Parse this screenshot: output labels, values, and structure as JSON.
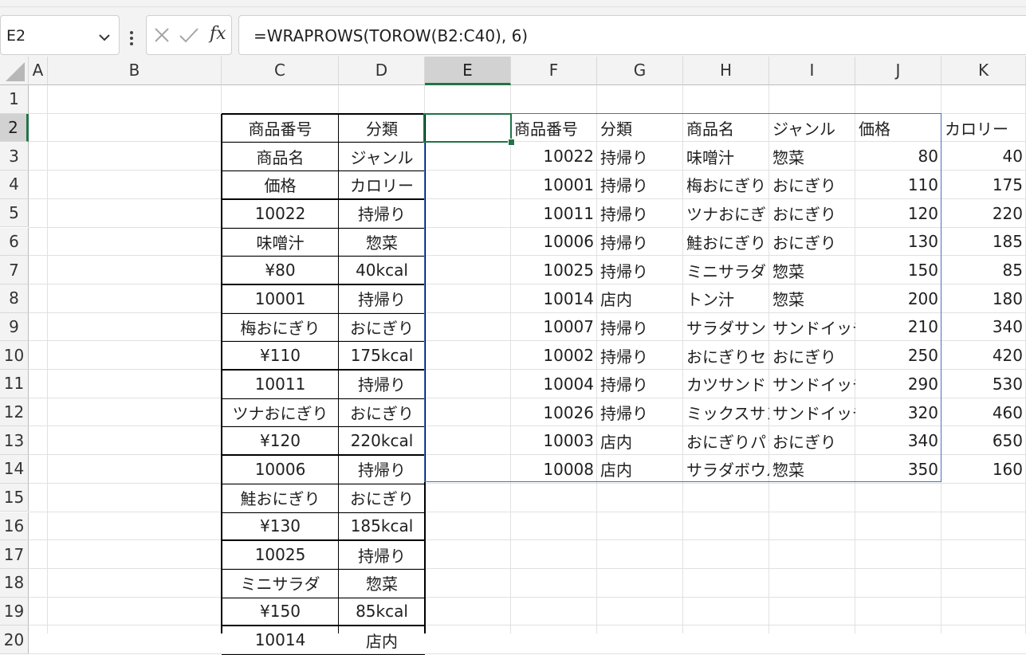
{
  "formula_bar": {
    "name_box": "E2",
    "fx_label": "fx",
    "formula": "=WRAPROWS(TOROW(B2:C40), 6)"
  },
  "icons": {
    "name_box_dropdown": "chevron-down-icon",
    "options": "vertical-dots-icon",
    "cancel": "x-icon",
    "enter": "check-icon",
    "insert_function": "fx-icon",
    "select_all": "select-all-triangle-icon"
  },
  "colors": {
    "selection": "#217346",
    "spill_border": "#4472c4",
    "header_bg": "#f3f3f3",
    "gridline": "#e1e1e1"
  },
  "sheet": {
    "columns": [
      "A",
      "B",
      "C",
      "D",
      "E",
      "F",
      "G",
      "H",
      "I",
      "J",
      "K"
    ],
    "rows": [
      "1",
      "2",
      "3",
      "4",
      "5",
      "6",
      "7",
      "8",
      "9",
      "10",
      "11",
      "12",
      "13",
      "14",
      "15",
      "16",
      "17",
      "18",
      "19",
      "20"
    ],
    "selected_column": "E",
    "selected_row": "2",
    "source_table": [
      [
        "商品番号",
        "分類"
      ],
      [
        "商品名",
        "ジャンル"
      ],
      [
        "価格",
        "カロリー"
      ],
      [
        "10022",
        "持帰り"
      ],
      [
        "味噌汁",
        "惣菜"
      ],
      [
        "¥80",
        "40kcal"
      ],
      [
        "10001",
        "持帰り"
      ],
      [
        "梅おにぎり",
        "おにぎり"
      ],
      [
        "¥110",
        "175kcal"
      ],
      [
        "10011",
        "持帰り"
      ],
      [
        "ツナおにぎり",
        "おにぎり"
      ],
      [
        "¥120",
        "220kcal"
      ],
      [
        "10006",
        "持帰り"
      ],
      [
        "鮭おにぎり",
        "おにぎり"
      ],
      [
        "¥130",
        "185kcal"
      ],
      [
        "10025",
        "持帰り"
      ],
      [
        "ミニサラダ",
        "惣菜"
      ],
      [
        "¥150",
        "85kcal"
      ],
      [
        "10014",
        "店内"
      ]
    ],
    "result_header": [
      "商品番号",
      "分類",
      "商品名",
      "ジャンル",
      "価格",
      "カロリー"
    ],
    "result_rows": [
      [
        "10022",
        "持帰り",
        "味噌汁",
        "惣菜",
        "80",
        "40"
      ],
      [
        "10001",
        "持帰り",
        "梅おにぎり",
        "おにぎり",
        "110",
        "175"
      ],
      [
        "10011",
        "持帰り",
        "ツナおにぎり",
        "おにぎり",
        "120",
        "220"
      ],
      [
        "10006",
        "持帰り",
        "鮭おにぎり",
        "おにぎり",
        "130",
        "185"
      ],
      [
        "10025",
        "持帰り",
        "ミニサラダ",
        "惣菜",
        "150",
        "85"
      ],
      [
        "10014",
        "店内",
        "トン汁",
        "惣菜",
        "200",
        "180"
      ],
      [
        "10007",
        "持帰り",
        "サラダサンド",
        "サンドイッチ",
        "210",
        "340"
      ],
      [
        "10002",
        "持帰り",
        "おにぎりセット",
        "おにぎり",
        "250",
        "420"
      ],
      [
        "10004",
        "持帰り",
        "カツサンド",
        "サンドイッチ",
        "290",
        "530"
      ],
      [
        "10026",
        "持帰り",
        "ミックスサンド",
        "サンドイッチ",
        "320",
        "460"
      ],
      [
        "10003",
        "店内",
        "おにぎりパック",
        "おにぎり",
        "340",
        "650"
      ],
      [
        "10008",
        "店内",
        "サラダボウル",
        "惣菜",
        "350",
        "160"
      ]
    ]
  }
}
